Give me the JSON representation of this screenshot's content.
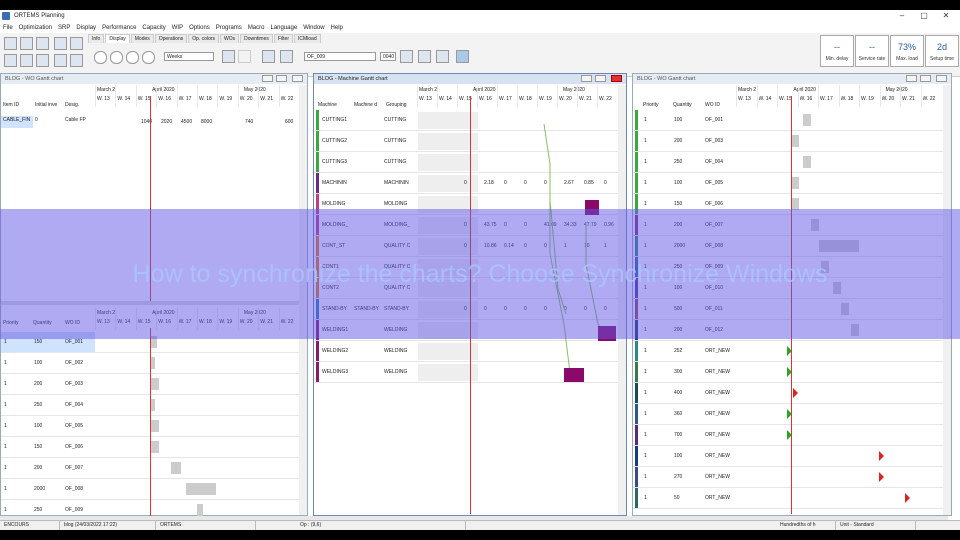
{
  "window": {
    "title": "ORTEMS  Planning",
    "min": "–",
    "max": "▢",
    "close": "✕"
  },
  "menu": [
    "File",
    "Optimization",
    "SRP",
    "Display",
    "Performance",
    "Capacity",
    "WIP",
    "Options",
    "Programs",
    "Macro",
    "Language",
    "Window",
    "Help"
  ],
  "toolbar": {
    "tabs": [
      "Info",
      "Display",
      "Modes",
      "Operations",
      "Op. colors",
      "WOs",
      "Downtimes",
      "Filter",
      "ICMload"
    ],
    "scale_value": "Weeks",
    "search_value": "OF_009",
    "search_count": "0040",
    "kpis": [
      {
        "value": "--",
        "label": "Min. delay"
      },
      {
        "value": "--",
        "label": "Service rate"
      },
      {
        "value": "73%",
        "label": "Max. load"
      },
      {
        "value": "2d",
        "label": "Setup time"
      }
    ]
  },
  "timeline": {
    "months": [
      "March 2",
      "April 2020",
      "May 2020"
    ],
    "weeks": [
      "W. 13",
      "W. 14",
      "W. 15",
      "W. 16",
      "W. 17",
      "W. 18",
      "W. 19",
      "W. 20",
      "W. 21",
      "W. 22"
    ]
  },
  "left_panel": {
    "title": "BLOG - WO Gantt chart",
    "top_headers": [
      "Item ID",
      "Initial inve",
      "Desig."
    ],
    "top_row": {
      "item": "CABLE_FIN",
      "initial": "0",
      "desig": "Cable FP"
    },
    "top_values": [
      "1040",
      "2020",
      "4500",
      "8000",
      "740",
      "600"
    ],
    "bottom_headers": [
      "Priority",
      "Quantity",
      "WO ID"
    ],
    "rows": [
      {
        "priority": "1",
        "quantity": "150",
        "wo": "OF_001"
      },
      {
        "priority": "1",
        "quantity": "100",
        "wo": "OF_002"
      },
      {
        "priority": "1",
        "quantity": "200",
        "wo": "OF_003"
      },
      {
        "priority": "1",
        "quantity": "250",
        "wo": "OF_004"
      },
      {
        "priority": "1",
        "quantity": "100",
        "wo": "OF_005"
      },
      {
        "priority": "1",
        "quantity": "150",
        "wo": "OF_006"
      },
      {
        "priority": "1",
        "quantity": "200",
        "wo": "OF_007"
      },
      {
        "priority": "1",
        "quantity": "2000",
        "wo": "OF_008"
      },
      {
        "priority": "1",
        "quantity": "250",
        "wo": "OF_009"
      }
    ]
  },
  "middle_panel": {
    "title": "BLOG - Machine Gantt chart",
    "headers": [
      "Machine",
      "Machine d",
      "Grouping"
    ],
    "rows": [
      {
        "machine": "CUTTING1",
        "desc": "",
        "group": "CUTTING",
        "color": "#3aaa3a"
      },
      {
        "machine": "CUTTING2",
        "desc": "",
        "group": "CUTTING",
        "color": "#3aaa3a"
      },
      {
        "machine": "CUTTING3",
        "desc": "",
        "group": "CUTTING",
        "color": "#3aaa3a"
      },
      {
        "machine": "MACHININ",
        "desc": "",
        "group": "MACHININ",
        "color": "#6a2a8a"
      },
      {
        "machine": "MOLDING",
        "desc": "",
        "group": "MOLDING",
        "color": "#c23b8a"
      },
      {
        "machine": "MOLDING_",
        "desc": "",
        "group": "MOLDING_",
        "color": "#c23b8a"
      },
      {
        "machine": "CONT_ST",
        "desc": "",
        "group": "QUALITY C",
        "color": "#e07a20"
      },
      {
        "machine": "CONT1",
        "desc": "",
        "group": "QUALITY C",
        "color": "#e07a20"
      },
      {
        "machine": "CONT2",
        "desc": "",
        "group": "QUALITY C",
        "color": "#e07a20"
      },
      {
        "machine": "STAND-BY",
        "desc": "STAND-BY",
        "group": "STAND-BY",
        "color": "#2a7acc"
      },
      {
        "machine": "WELDING1",
        "desc": "",
        "group": "WELDING",
        "color": "#8a1a6a"
      },
      {
        "machine": "WELDING2",
        "desc": "",
        "group": "WELDING",
        "color": "#8a1a6a"
      },
      {
        "machine": "WELDING3",
        "desc": "",
        "group": "WELDING",
        "color": "#8a1a6a"
      }
    ],
    "load_rows": [
      {
        "row": 3,
        "values": [
          "0",
          "2.18",
          "0",
          "0",
          "0",
          "2.67",
          "0.85",
          "0"
        ]
      },
      {
        "row": 5,
        "values": [
          "0",
          "43.75",
          "0",
          "0",
          "41.09",
          "34.33",
          "47.79",
          "0.96"
        ]
      },
      {
        "row": 6,
        "values": [
          "0",
          "10.86",
          "0.14",
          "0",
          "0",
          "1",
          "10",
          "1"
        ]
      },
      {
        "row": 9,
        "values": [
          "0",
          "0",
          "0",
          "0",
          "0",
          "0",
          "0",
          "0"
        ]
      }
    ]
  },
  "right_panel": {
    "title": "BLOG - WO Gantt chart",
    "headers": [
      "Priority",
      "Quantity",
      "WO ID"
    ],
    "rows": [
      {
        "priority": "1",
        "quantity": "100",
        "wo": "OF_001",
        "color": "#3aaa3a"
      },
      {
        "priority": "1",
        "quantity": "200",
        "wo": "OF_003",
        "color": "#3aaa3a"
      },
      {
        "priority": "1",
        "quantity": "250",
        "wo": "OF_004",
        "color": "#3aaa3a"
      },
      {
        "priority": "1",
        "quantity": "100",
        "wo": "OF_005",
        "color": "#3aaa3a"
      },
      {
        "priority": "1",
        "quantity": "150",
        "wo": "OF_006",
        "color": "#3aaa3a"
      },
      {
        "priority": "1",
        "quantity": "200",
        "wo": "OF_007",
        "color": "#8a2a8a"
      },
      {
        "priority": "1",
        "quantity": "2000",
        "wo": "OF_008",
        "color": "#2a8a7a"
      },
      {
        "priority": "1",
        "quantity": "250",
        "wo": "OF_009",
        "color": "#2a6a9a"
      },
      {
        "priority": "1",
        "quantity": "100",
        "wo": "OF_010",
        "color": "#4a3a9a"
      },
      {
        "priority": "1",
        "quantity": "500",
        "wo": "OF_011",
        "color": "#8a4a6a"
      },
      {
        "priority": "1",
        "quantity": "200",
        "wo": "OF_012",
        "color": "#1a3a6a"
      },
      {
        "priority": "1",
        "quantity": "252",
        "wo": "ORT_NEW",
        "color": "#2a8a8a"
      },
      {
        "priority": "1",
        "quantity": "300",
        "wo": "ORT_NEW",
        "color": "#3a7a4a"
      },
      {
        "priority": "1",
        "quantity": "400",
        "wo": "ORT_NEW",
        "color": "#1a4a5a"
      },
      {
        "priority": "1",
        "quantity": "360",
        "wo": "ORT_NEW",
        "color": "#2a5a8a"
      },
      {
        "priority": "1",
        "quantity": "700",
        "wo": "ORT_NEW",
        "color": "#5a2a7a"
      },
      {
        "priority": "1",
        "quantity": "100",
        "wo": "ORT_NEW",
        "color": "#1a3a7a"
      },
      {
        "priority": "1",
        "quantity": "270",
        "wo": "ORT_NEW",
        "color": "#3a4a8a"
      },
      {
        "priority": "1",
        "quantity": "50",
        "wo": "ORT_NEW",
        "color": "#2a6a5a"
      }
    ]
  },
  "overlay_caption": "How to synchronize the charts? Choose Synchronize Windows",
  "status": [
    "ENCOURS",
    "blog (24/03/2022 17:22)",
    "ORTEMS",
    "",
    "Op : (9,6)",
    "",
    "Hundredths of h",
    "Unit - Standard"
  ]
}
